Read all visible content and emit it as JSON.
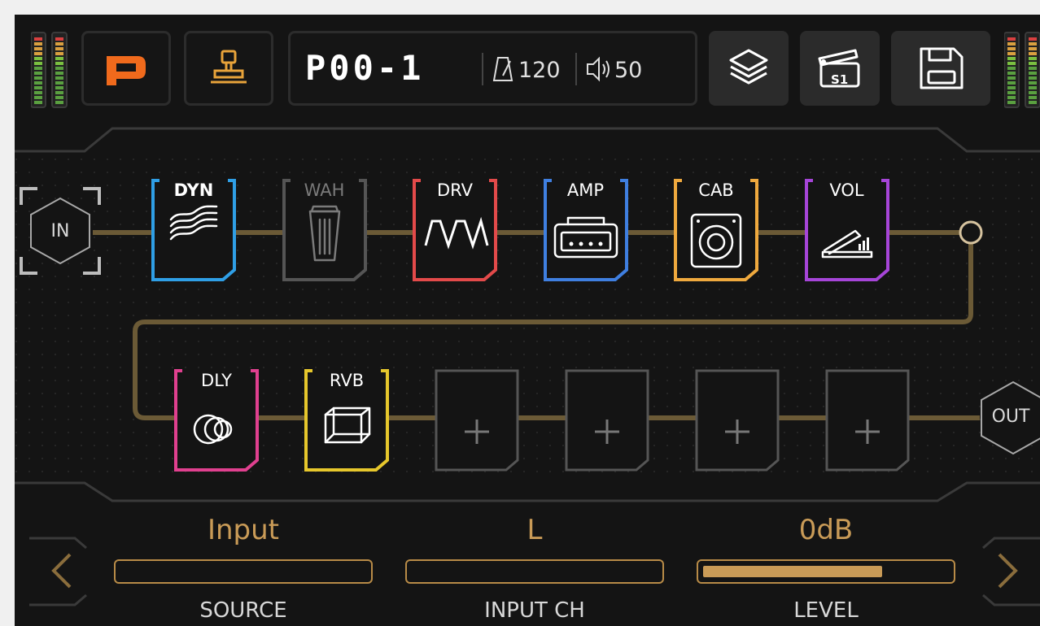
{
  "header": {
    "preset_name": "P00-1",
    "tempo": "120",
    "volume": "50",
    "logo_icon": "p-logo-icon",
    "ir_icon": "stamp-icon",
    "buttons": [
      "layers-icon",
      "scene-clapper-icon",
      "save-icon"
    ],
    "scene_label": "S1"
  },
  "chain": {
    "in_label": "IN",
    "out_label": "OUT",
    "row1": [
      {
        "label": "DYN",
        "color": "#2f9fe6",
        "icon": "waves-icon",
        "active": true
      },
      {
        "label": "WAH",
        "color": "#555555",
        "icon": "wah-icon",
        "active": false
      },
      {
        "label": "DRV",
        "color": "#e34a4a",
        "icon": "square-wave-icon",
        "active": true
      },
      {
        "label": "AMP",
        "color": "#3f7fe0",
        "icon": "amp-icon",
        "active": true
      },
      {
        "label": "CAB",
        "color": "#efa93e",
        "icon": "speaker-icon",
        "active": true
      },
      {
        "label": "VOL",
        "color": "#a645d8",
        "icon": "volume-pedal-icon",
        "active": true
      }
    ],
    "row2": [
      {
        "label": "DLY",
        "color": "#e0408f",
        "icon": "delay-circles-icon",
        "active": true
      },
      {
        "label": "RVB",
        "color": "#e6c72c",
        "icon": "reverb-cube-icon",
        "active": true
      },
      {
        "label": "",
        "color": "#555555",
        "icon": "plus-icon",
        "active": false
      },
      {
        "label": "",
        "color": "#555555",
        "icon": "plus-icon",
        "active": false
      },
      {
        "label": "",
        "color": "#555555",
        "icon": "plus-icon",
        "active": false
      },
      {
        "label": "",
        "color": "#555555",
        "icon": "plus-icon",
        "active": false
      }
    ]
  },
  "params": [
    {
      "value": "Input",
      "name": "SOURCE",
      "level": 0
    },
    {
      "value": "L",
      "name": "INPUT CH",
      "level": 0
    },
    {
      "value": "0dB",
      "name": "LEVEL",
      "level": 0.73
    }
  ],
  "colors": {
    "accent": "#d09a4e",
    "chain_line": "#6b5a36",
    "panel_bg": "#141414"
  }
}
